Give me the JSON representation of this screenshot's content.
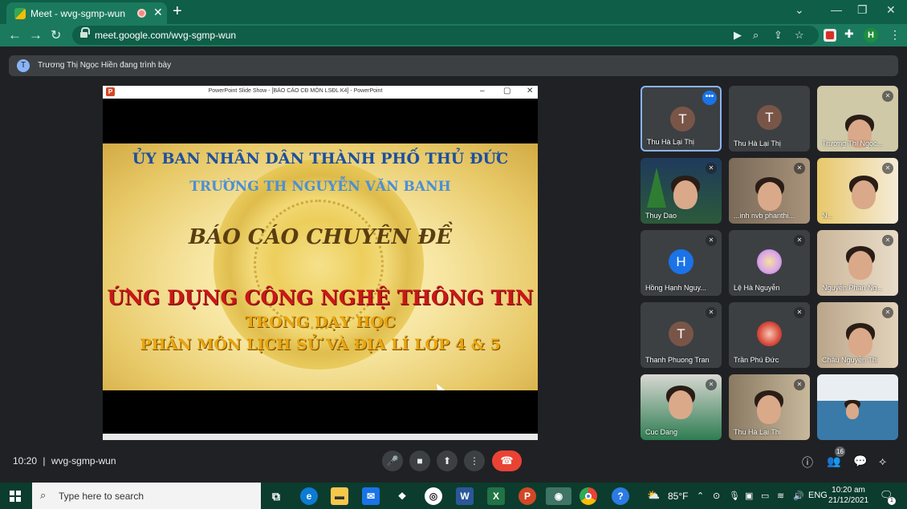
{
  "browser": {
    "tab_title": "Meet - wvg-sgmp-wun",
    "url": "meet.google.com/wvg-sgmp-wun",
    "profile_initial": "H"
  },
  "presenting_banner": {
    "avatar_initial": "T",
    "text": "Trương Thị Ngọc Hiền đang trình bày"
  },
  "slideshow": {
    "window_title": "PowerPoint Slide Show - [BÁO CÁO CĐ MÔN LSĐL K4] - PowerPoint",
    "lines": [
      "ỦY BAN NHÂN DÂN THÀNH PHỐ THỦ ĐỨC",
      "TRƯỜNG TH NGUYỄN VĂN BANH",
      "BÁO CÁO CHUYÊN ĐỀ",
      "ỨNG DỤNG CÔNG NGHỆ THÔNG TIN",
      "TRONG DẠY HỌC",
      "PHÂN MÔN LỊCH SỬ VÀ ĐỊA LÍ LỚP 4 & 5"
    ]
  },
  "participants": [
    {
      "name": "Thu Hà Lại Thị",
      "initial": "T"
    },
    {
      "name": "Thu Hà Lại Thị",
      "initial": "T"
    },
    {
      "name": "Trương Thị Ngọc..."
    },
    {
      "name": "Thuy Dao"
    },
    {
      "name": "...inh nvb phanthi..."
    },
    {
      "name": "N..."
    },
    {
      "name": "Hồng Hạnh Nguy...",
      "initial": "H"
    },
    {
      "name": "Lệ Hà Nguyễn"
    },
    {
      "name": "Nguyễn Phan Ng..."
    },
    {
      "name": "Thanh Phuong Tran",
      "initial": "T"
    },
    {
      "name": "Trần Phú Đức"
    },
    {
      "name": "Châu Nguyễn Thị"
    },
    {
      "name": "Cuc Dang"
    },
    {
      "name": "Thu Hà Lại Thị"
    },
    {
      "name": ""
    }
  ],
  "meeting_bar": {
    "time": "10:20",
    "separator": "|",
    "code": "wvg-sgmp-wun",
    "participant_count": "16"
  },
  "taskbar": {
    "search_placeholder": "Type here to search",
    "weather": "85°F",
    "language": "ENG",
    "clock_time": "10:20 am",
    "clock_date": "21/12/2021",
    "notification_count": "1"
  }
}
